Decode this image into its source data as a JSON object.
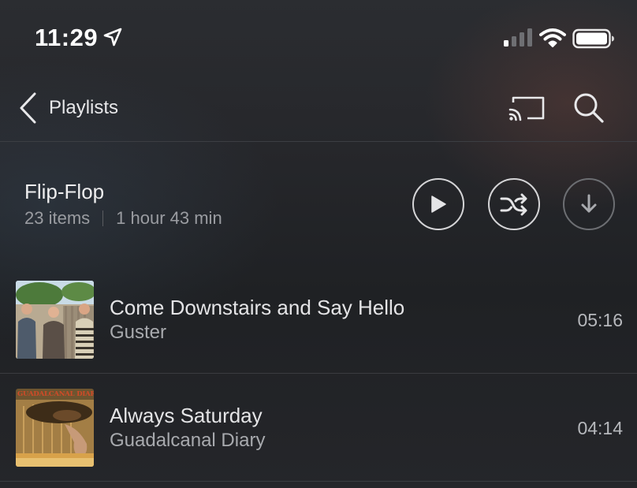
{
  "status_bar": {
    "time": "11:29",
    "icons": [
      "location-arrow-icon",
      "cellular-signal-icon",
      "wifi-icon",
      "battery-icon"
    ]
  },
  "nav": {
    "back_label": "Playlists",
    "icons": [
      "chevron-left-icon",
      "cast-icon",
      "search-icon"
    ]
  },
  "playlist": {
    "title": "Flip-Flop",
    "item_count": "23 items",
    "duration": "1 hour 43 min",
    "actions": [
      "play-icon",
      "shuffle-icon",
      "download-icon"
    ]
  },
  "tracks": [
    {
      "title": "Come Downstairs and Say Hello",
      "artist": "Guster",
      "duration": "05:16"
    },
    {
      "title": "Always Saturday",
      "artist": "Guadalcanal Diary",
      "duration": "04:14",
      "art_text": "GUADALCANAL DIARY"
    }
  ],
  "colors": {
    "background": "#232428",
    "text_primary": "#e6e6e8",
    "text_secondary": "#9a9ca1",
    "divider": "#3a3c40"
  }
}
